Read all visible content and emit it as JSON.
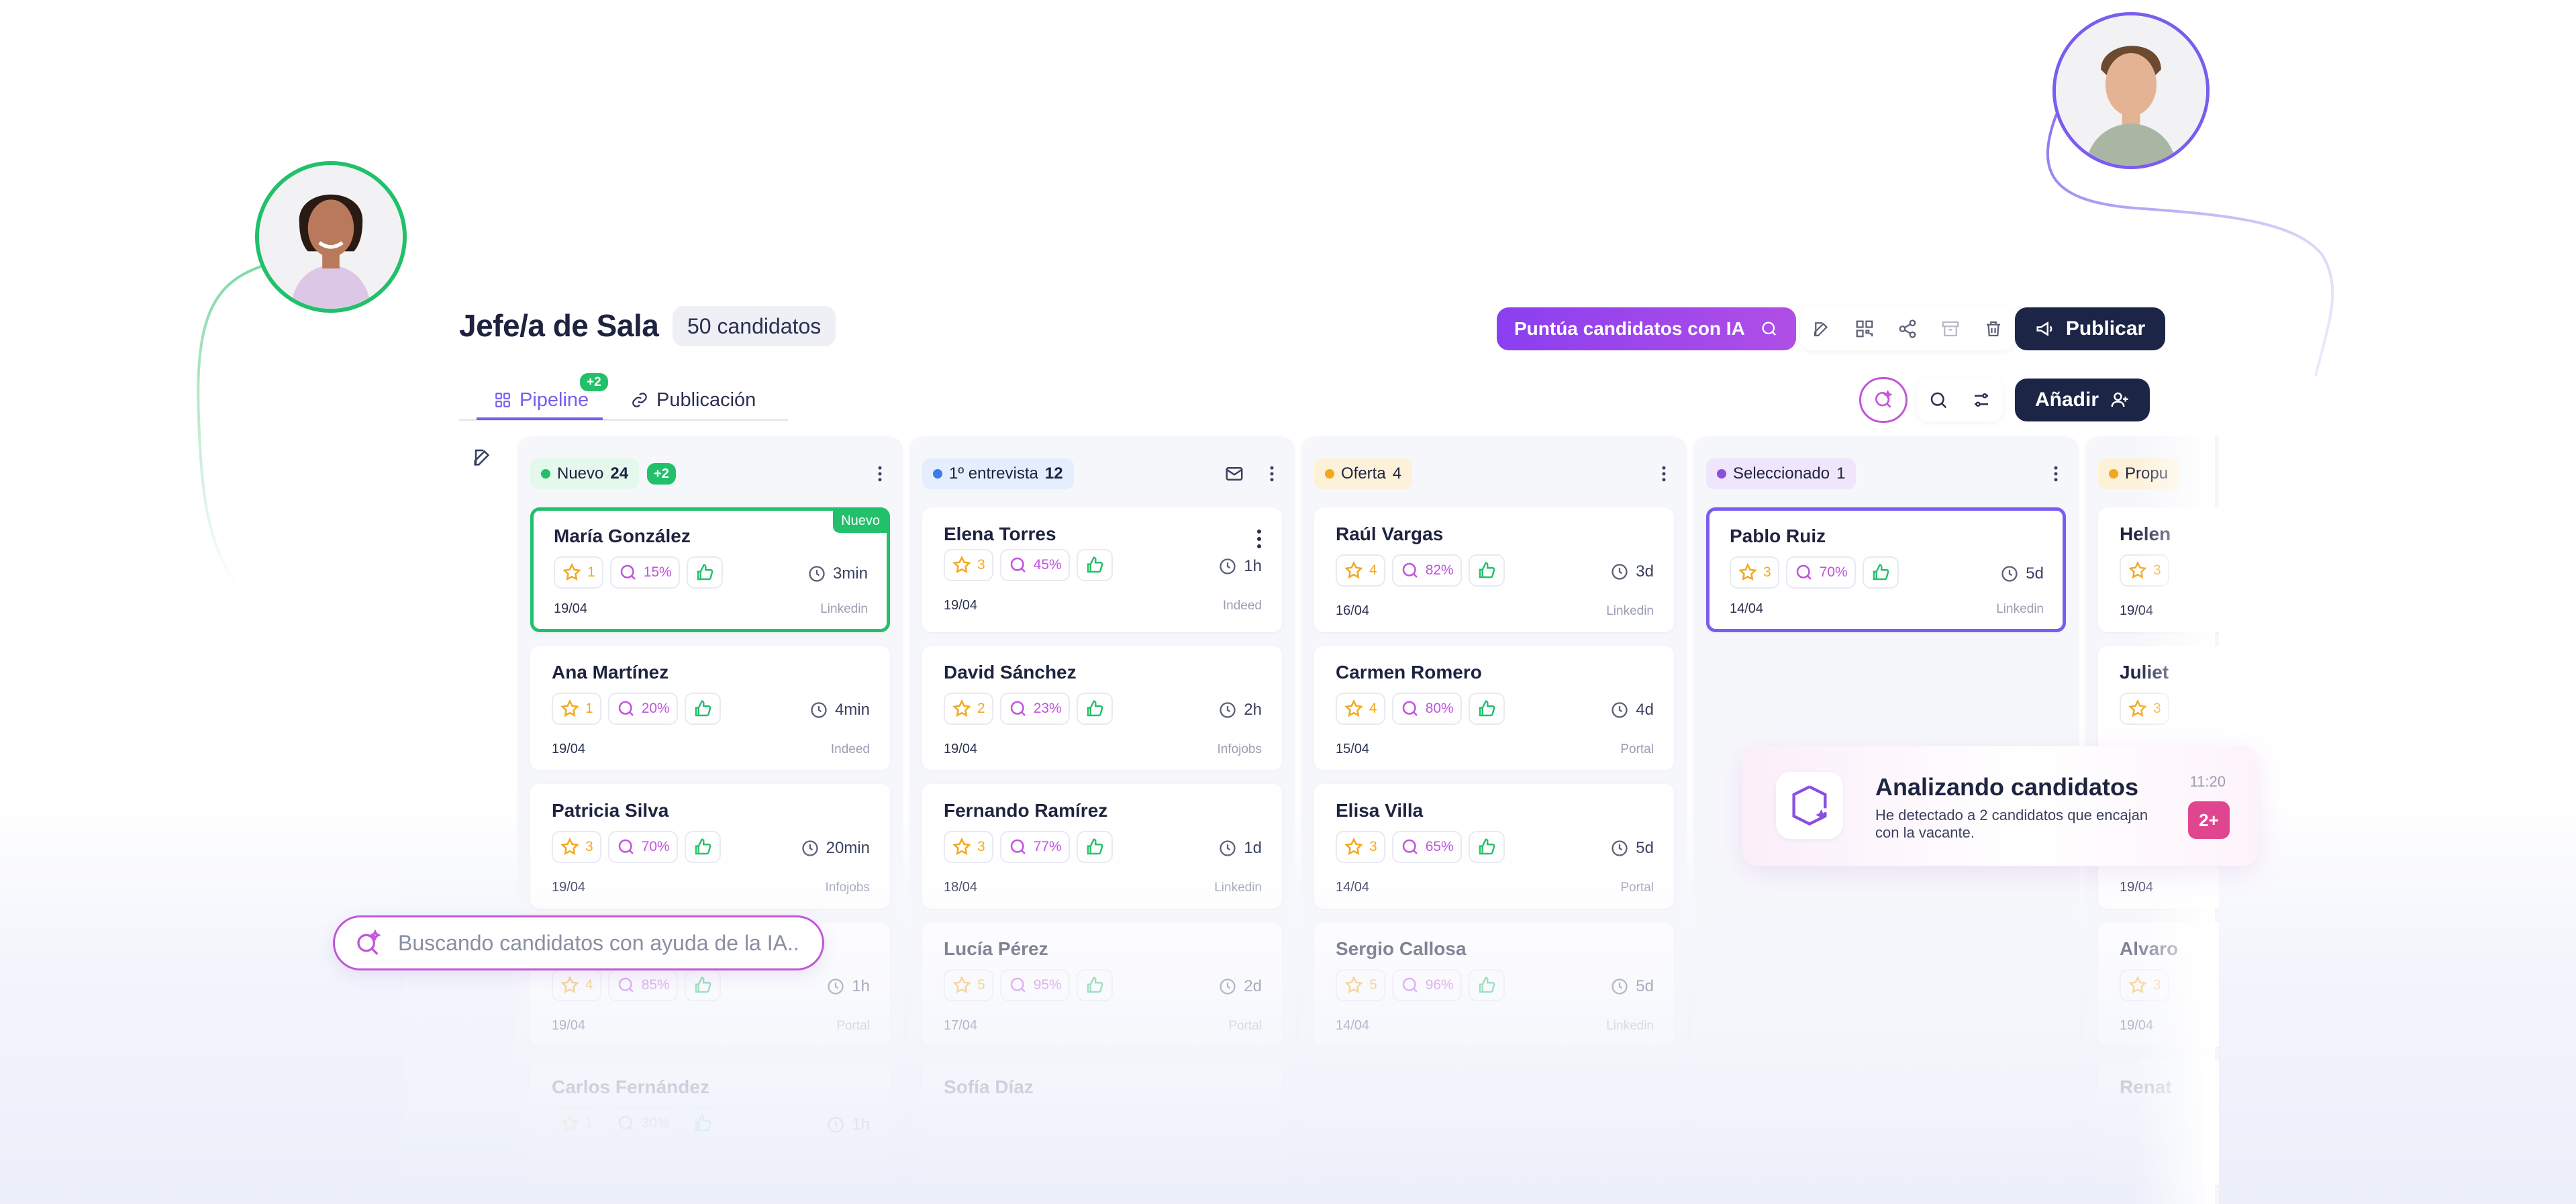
{
  "header": {
    "title": "Jefe/a de Sala",
    "candidate_count": "50 candidatos",
    "ai_score_label": "Puntúa candidatos con IA",
    "publish_label": "Publicar"
  },
  "tabs": [
    {
      "label": "Pipeline",
      "active": true,
      "counter": "+2"
    },
    {
      "label": "Publicación",
      "active": false
    }
  ],
  "toolbar": {
    "add_label": "Añadir"
  },
  "columns": [
    {
      "stage": "Nuevo",
      "count": "24",
      "counter": "+2",
      "color": "#22c06a",
      "pill_bg": "#e4f8ec",
      "cards": [
        {
          "name": "María González",
          "stars": "1",
          "ai": "15%",
          "time": "3min",
          "date": "19/04",
          "source": "Linkedin",
          "badge": "Nuevo"
        },
        {
          "name": "Ana Martínez",
          "stars": "1",
          "ai": "20%",
          "time": "4min",
          "date": "19/04",
          "source": "Indeed"
        },
        {
          "name": "Patricia Silva",
          "stars": "3",
          "ai": "70%",
          "time": "20min",
          "date": "19/04",
          "source": "Infojobs"
        },
        {
          "name": "",
          "stars": "4",
          "ai": "85%",
          "time": "1h",
          "date": "19/04",
          "source": "Portal"
        },
        {
          "name": "Carlos Fernández",
          "stars": "1",
          "ai": "30%",
          "time": "1h",
          "date": "",
          "source": ""
        }
      ]
    },
    {
      "stage": "1º entrevista",
      "count": "12",
      "color": "#3d7be8",
      "pill_bg": "#e5eefc",
      "cards": [
        {
          "name": "Elena Torres",
          "stars": "3",
          "ai": "45%",
          "time": "1h",
          "date": "19/04",
          "source": "Indeed"
        },
        {
          "name": "David Sánchez",
          "stars": "2",
          "ai": "23%",
          "time": "2h",
          "date": "19/04",
          "source": "Infojobs"
        },
        {
          "name": "Fernando Ramírez",
          "stars": "3",
          "ai": "77%",
          "time": "1d",
          "date": "18/04",
          "source": "Linkedin"
        },
        {
          "name": "Lucía Pérez",
          "stars": "5",
          "ai": "95%",
          "time": "2d",
          "date": "17/04",
          "source": "Portal"
        },
        {
          "name": "Sofía Díaz",
          "stars": "",
          "ai": "",
          "time": "",
          "date": "",
          "source": ""
        }
      ]
    },
    {
      "stage": "Oferta",
      "count": "4",
      "color": "#f2a81d",
      "pill_bg": "#fdf1d9",
      "cards": [
        {
          "name": "Raúl Vargas",
          "stars": "4",
          "ai": "82%",
          "time": "3d",
          "date": "16/04",
          "source": "Linkedin"
        },
        {
          "name": "Carmen Romero",
          "stars": "4",
          "ai": "80%",
          "time": "4d",
          "date": "15/04",
          "source": "Portal"
        },
        {
          "name": "Elisa Villa",
          "stars": "3",
          "ai": "65%",
          "time": "5d",
          "date": "14/04",
          "source": "Portal"
        },
        {
          "name": "Sergio Callosa",
          "stars": "5",
          "ai": "96%",
          "time": "5d",
          "date": "14/04",
          "source": "Linkedin"
        }
      ]
    },
    {
      "stage": "Seleccionado",
      "count": "1",
      "color": "#8b4fe0",
      "pill_bg": "#efe6fc",
      "cards": [
        {
          "name": "Pablo Ruiz",
          "stars": "3",
          "ai": "70%",
          "time": "5d",
          "date": "14/04",
          "source": "Linkedin"
        }
      ]
    },
    {
      "stage": "Propu",
      "count": "",
      "color": "#f2a81d",
      "pill_bg": "#fdf1d9",
      "cards": [
        {
          "name": "Helen",
          "stars": "3",
          "date": "19/04"
        },
        {
          "name": "Juliet",
          "stars": "3",
          "date": ""
        },
        {
          "name": "",
          "stars": "",
          "date": "19/04"
        },
        {
          "name": "Alvaro",
          "stars": "3",
          "date": "19/04"
        },
        {
          "name": "Renat",
          "stars": "",
          "date": ""
        }
      ]
    }
  ],
  "ai_search": {
    "placeholder": "Buscando candidatos con ayuda de la IA..."
  },
  "notification": {
    "title": "Analizando candidatos",
    "body": "He detectado a 2 candidatos que encajan con la vacante.",
    "time": "11:20",
    "badge": "2+"
  }
}
